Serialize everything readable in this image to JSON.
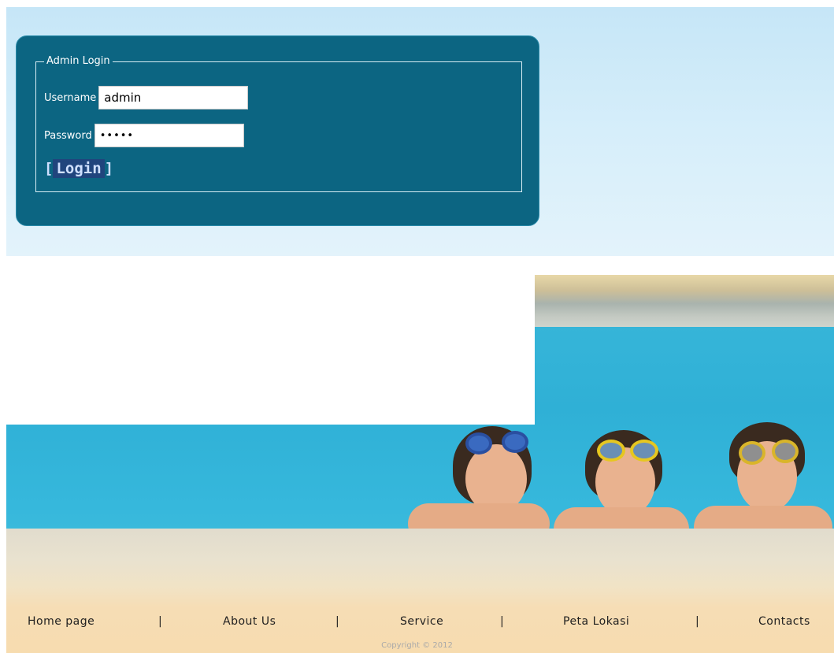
{
  "login": {
    "legend": "Admin Login",
    "username_label": "Username",
    "username_value": "admin",
    "password_label": "Password",
    "password_value": "•••••",
    "button_label": "Login"
  },
  "footer": {
    "nav": [
      "Home page",
      "About Us",
      "Service",
      "Peta Lokasi",
      "Contacts"
    ],
    "separator": "|",
    "copyright": "Copyright © 2012"
  },
  "colors": {
    "panel": "#0c6582",
    "sky": "#c6e6f7",
    "footer_bg": "#f6ddb5",
    "button_bg": "#20457d"
  }
}
